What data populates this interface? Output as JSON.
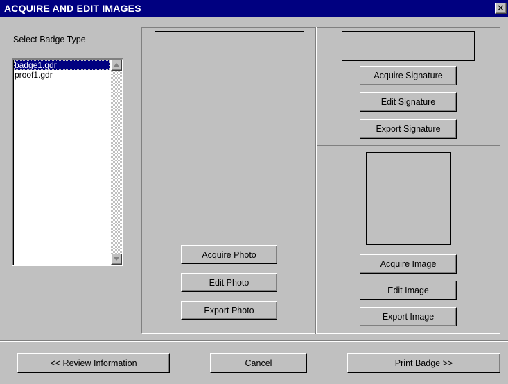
{
  "window": {
    "title": "ACQUIRE AND EDIT IMAGES",
    "close_glyph": "✕"
  },
  "badge_type": {
    "label": "Select Badge Type",
    "items": [
      {
        "label": "badge1.gdr",
        "selected": true
      },
      {
        "label": "proof1.gdr",
        "selected": false
      }
    ]
  },
  "photo": {
    "acquire": "Acquire Photo",
    "edit": "Edit Photo",
    "export": "Export Photo"
  },
  "signature": {
    "acquire": "Acquire Signature",
    "edit": "Edit Signature",
    "export": "Export Signature"
  },
  "image": {
    "acquire": "Acquire Image",
    "edit": "Edit Image",
    "export": "Export Image"
  },
  "footer": {
    "review": "<< Review Information",
    "cancel": "Cancel",
    "print": "Print Badge >>"
  },
  "colors": {
    "titlebar": "#000080",
    "face": "#c0c0c0",
    "selection": "#000080"
  }
}
